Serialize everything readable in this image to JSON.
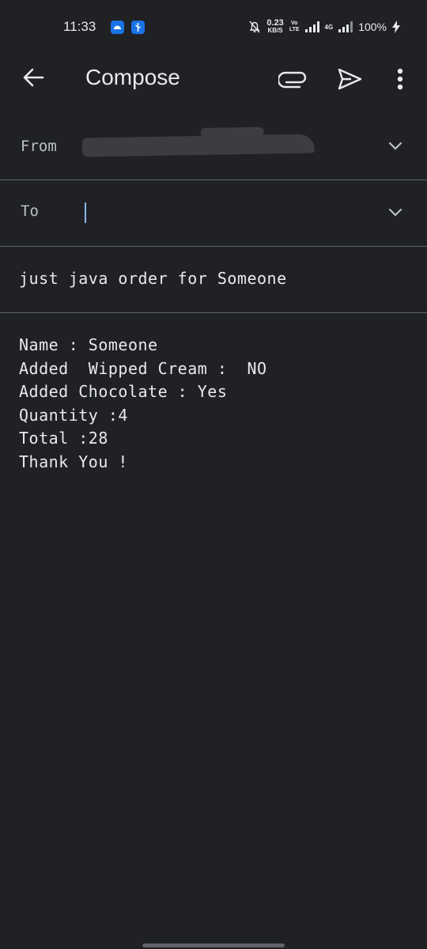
{
  "status_bar": {
    "time": "11:33",
    "notification_icons": [
      "android-icon",
      "usb-icon"
    ],
    "speed_value": "0.23",
    "speed_unit": "KB/S",
    "volte_top": "Vo",
    "volte_bottom": "LTE",
    "network_label": "4G",
    "battery": "100%",
    "icons": [
      "mute-bell-icon",
      "signal-icon",
      "signal-icon",
      "battery-charging-icon"
    ]
  },
  "app_bar": {
    "title": "Compose",
    "icons": [
      "back-arrow-icon",
      "attach-icon",
      "send-icon",
      "more-vert-icon"
    ]
  },
  "from": {
    "label": "From",
    "value_redacted": true
  },
  "to": {
    "label": "To",
    "value": ""
  },
  "subject": "just java order for Someone",
  "body": {
    "lines": [
      "Name : Someone",
      "Added  Wipped Cream :  NO",
      "Added Chocolate : Yes",
      "Quantity :4",
      "Total :28",
      "Thank You !"
    ]
  },
  "colors": {
    "background": "#202124",
    "text": "#e8eaed",
    "divider": "#5f6368",
    "cursor": "#8ab4f8",
    "badge": "#1a73e8"
  }
}
